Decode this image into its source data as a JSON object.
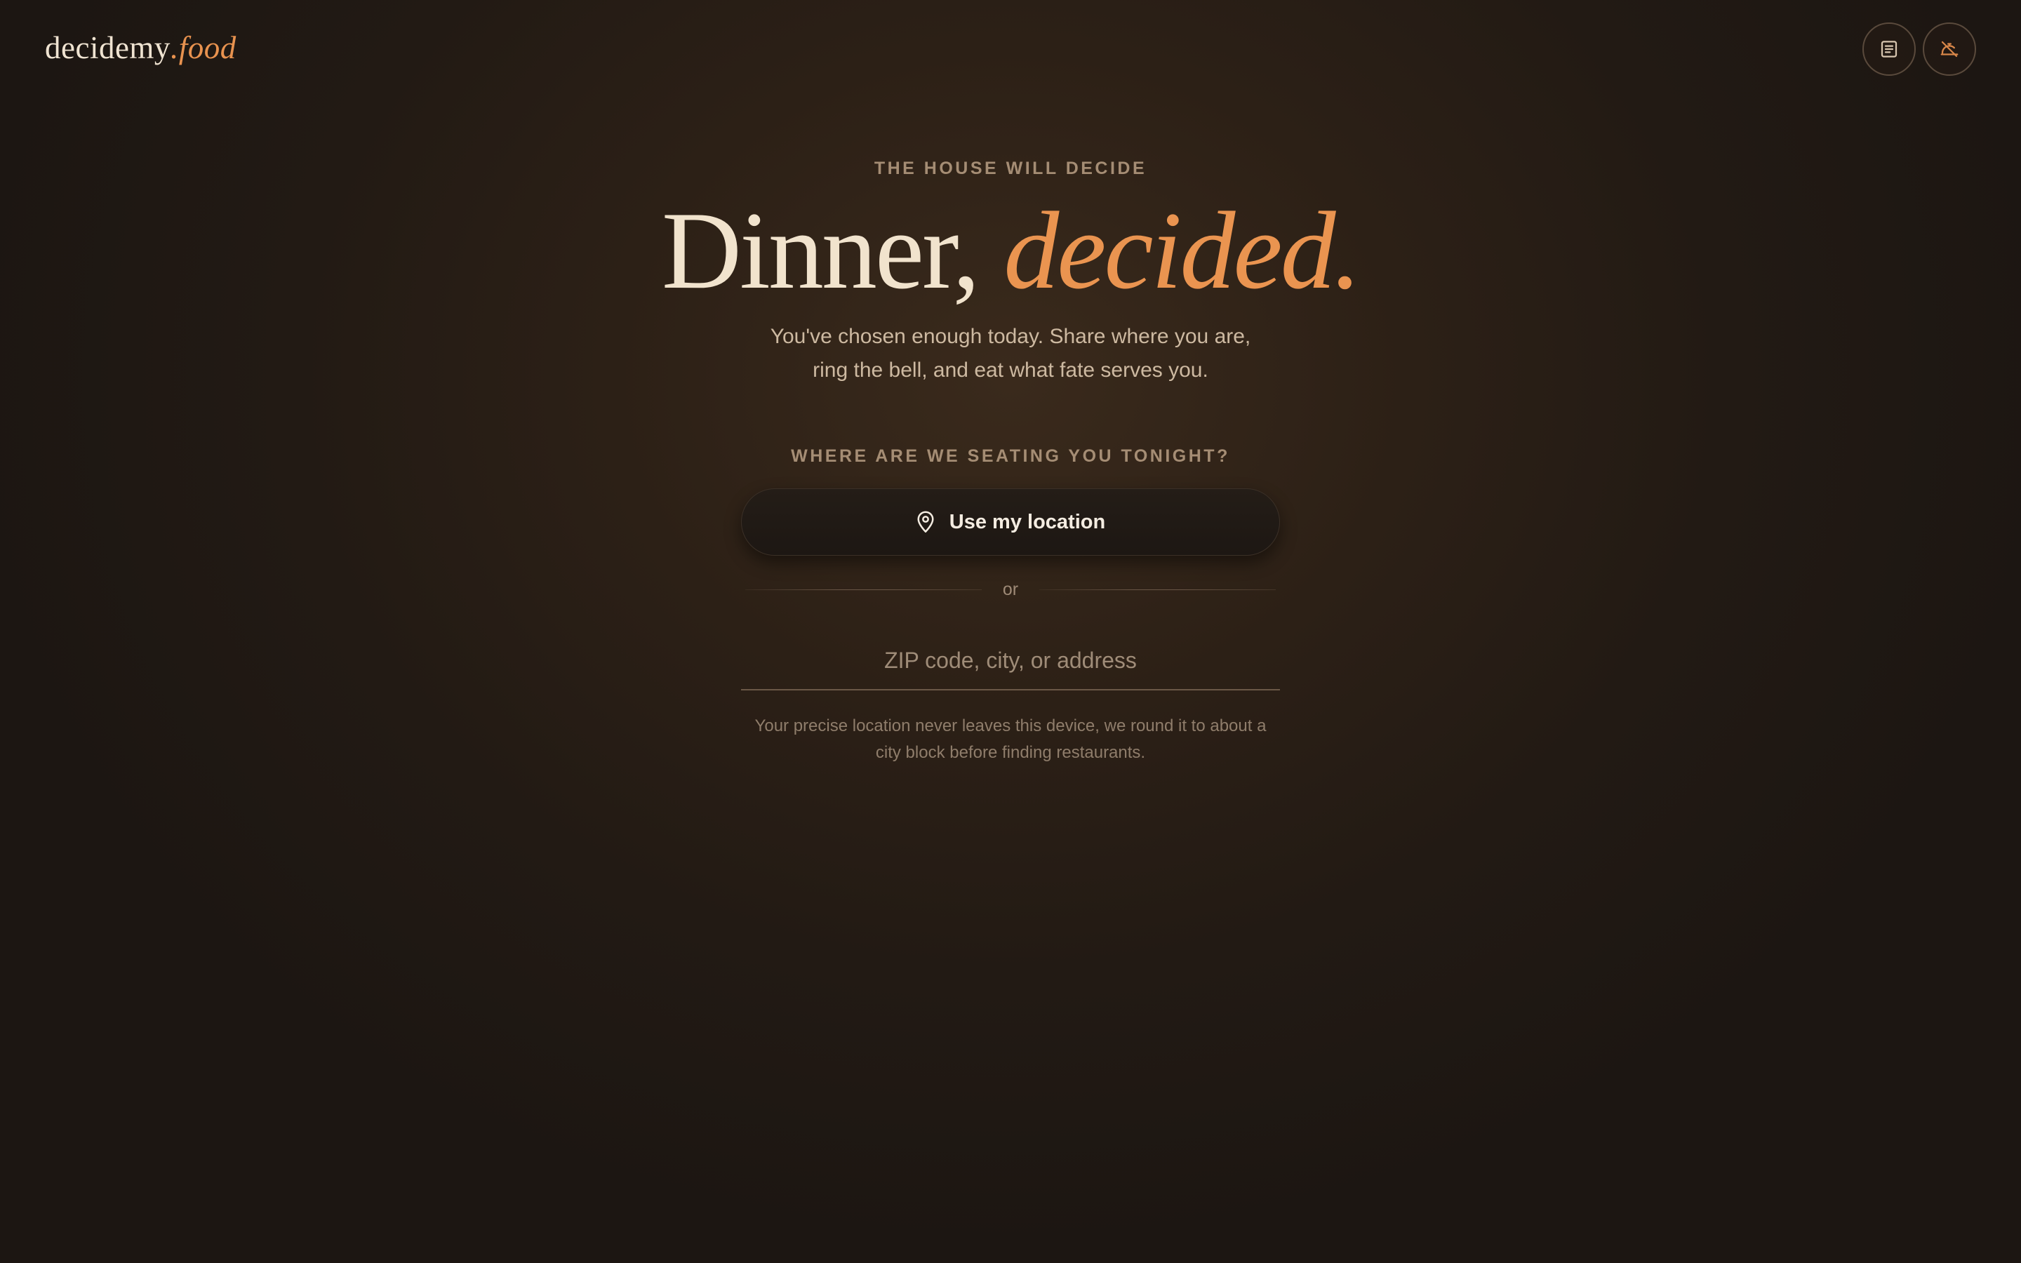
{
  "brand": {
    "name_main": "decidemy",
    "name_accent": ".food"
  },
  "top_actions": [
    {
      "icon": "menu-list-icon"
    },
    {
      "icon": "cloche-off-icon"
    }
  ],
  "hero": {
    "eyebrow": "THE HOUSE WILL DECIDE",
    "headline_main": "Dinner,",
    "headline_accent": "decided.",
    "subtitle_line1": "You've chosen enough today. Share where you are,",
    "subtitle_line2": "ring the bell, and eat what fate serves you."
  },
  "location": {
    "section_label": "WHERE ARE WE SEATING YOU TONIGHT?",
    "use_location_label": "Use my location",
    "use_location_icon": "map-pin-icon",
    "divider_text": "or",
    "address_placeholder": "ZIP code, city, or address",
    "address_value": "",
    "privacy_line1": "Your precise location never leaves this device, we round it to about a",
    "privacy_line2": "city block before finding restaurants."
  },
  "colors": {
    "accent": "#e8924f",
    "text_primary": "#efe3d1",
    "text_muted": "#a58d74",
    "background": "#2c2016"
  }
}
